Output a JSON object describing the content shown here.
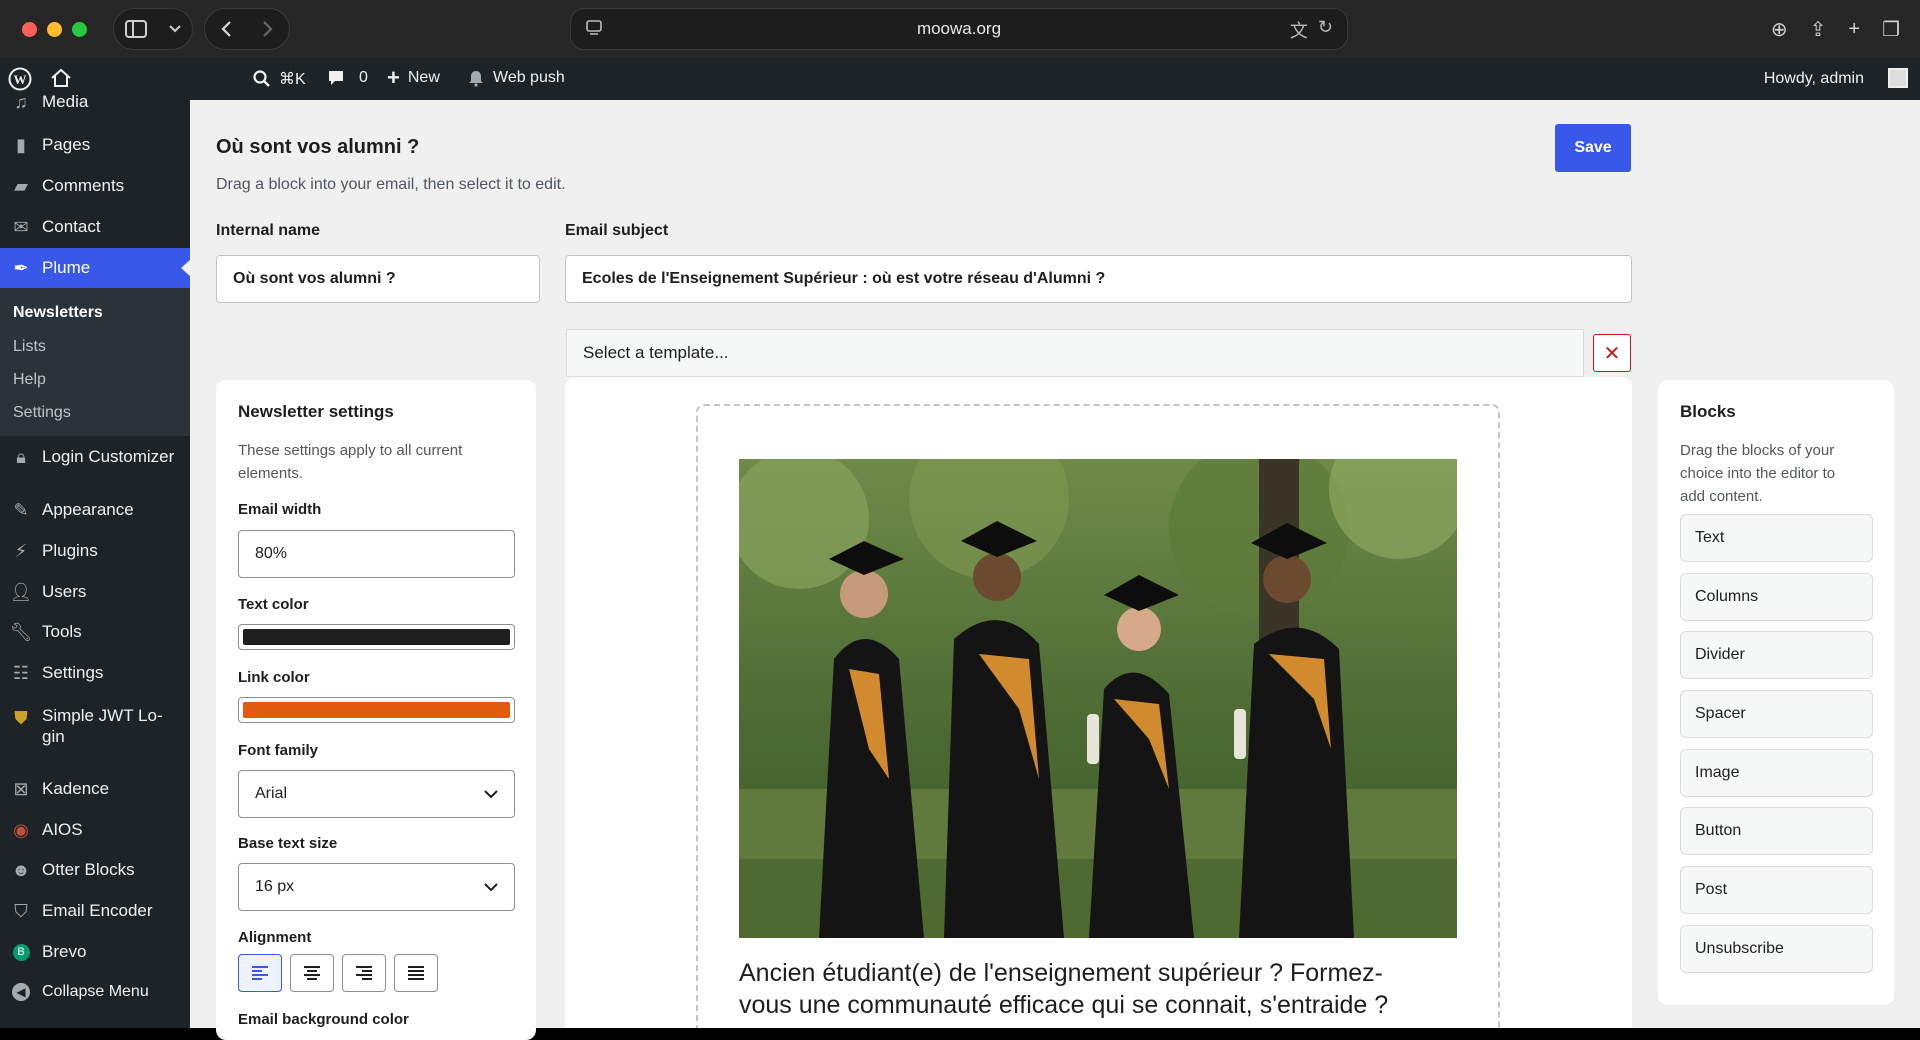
{
  "browser": {
    "url": "moowa.org"
  },
  "adminbar": {
    "search_shortcut": "⌘K",
    "comments_count": "0",
    "new_label": "New",
    "webpush_label": "Web push",
    "howdy": "Howdy, admin"
  },
  "sidebar": {
    "items": [
      {
        "label": "Media",
        "icon": "media-icon"
      },
      {
        "label": "Pages",
        "icon": "pages-icon"
      },
      {
        "label": "Comments",
        "icon": "comments-icon"
      },
      {
        "label": "Contact",
        "icon": "mail-icon"
      },
      {
        "label": "Plume",
        "icon": "feather-icon"
      },
      {
        "label": "Login Customizer",
        "icon": "lock-icon"
      },
      {
        "label": "Appearance",
        "icon": "brush-icon"
      },
      {
        "label": "Plugins",
        "icon": "plug-icon"
      },
      {
        "label": "Users",
        "icon": "user-icon"
      },
      {
        "label": "Tools",
        "icon": "wrench-icon"
      },
      {
        "label": "Settings",
        "icon": "sliders-icon"
      },
      {
        "label": "Simple JWT Lo-",
        "label2": "gin",
        "icon": "shield-icon"
      },
      {
        "label": "Kadence",
        "icon": "kadence-icon"
      },
      {
        "label": "AIOS",
        "icon": "aios-icon"
      },
      {
        "label": "Otter Blocks",
        "icon": "otter-icon"
      },
      {
        "label": "Email Encoder",
        "icon": "shield-icon"
      },
      {
        "label": "Brevo",
        "icon": "brevo-icon"
      },
      {
        "label": "Collapse Menu",
        "icon": "collapse-icon"
      }
    ],
    "submenu": [
      "Newsletters",
      "Lists",
      "Help",
      "Settings"
    ]
  },
  "page": {
    "title": "Où sont vos alumni ?",
    "description": "Drag a block into your email, then select it to edit.",
    "save_label": "Save",
    "internal_name_label": "Internal name",
    "internal_name_value": "Où sont vos alumni ?",
    "email_subject_label": "Email subject",
    "email_subject_value": "Ecoles de l'Enseignement Supérieur : où est votre réseau d'Alumni ?",
    "template_placeholder": "Select a template..."
  },
  "settings": {
    "title": "Newsletter settings",
    "desc_line1": "These settings apply to all current",
    "desc_line2": "elements.",
    "email_width_label": "Email width",
    "email_width_value": "80%",
    "text_color_label": "Text color",
    "text_color": "#1e1e1e",
    "link_color_label": "Link color",
    "link_color": "#e05a10",
    "font_family_label": "Font family",
    "font_family_value": "Arial",
    "base_text_size_label": "Base text size",
    "base_text_size_value": "16 px",
    "alignment_label": "Alignment",
    "bg_color_label": "Email background color"
  },
  "email": {
    "text_line1": "Ancien étudiant(e) de l'enseignement supérieur ? Formez-",
    "text_line2": "vous une communauté efficace qui se connait, s'entraide ?"
  },
  "blocks": {
    "title": "Blocks",
    "desc_line1": "Drag the blocks of your",
    "desc_line2": "choice into the editor to",
    "desc_line3": "add content.",
    "items": [
      "Text",
      "Columns",
      "Divider",
      "Spacer",
      "Image",
      "Button",
      "Post",
      "Unsubscribe"
    ]
  },
  "colors": {
    "accent": "#3858e9",
    "sidebar_bg": "#1d2327"
  }
}
